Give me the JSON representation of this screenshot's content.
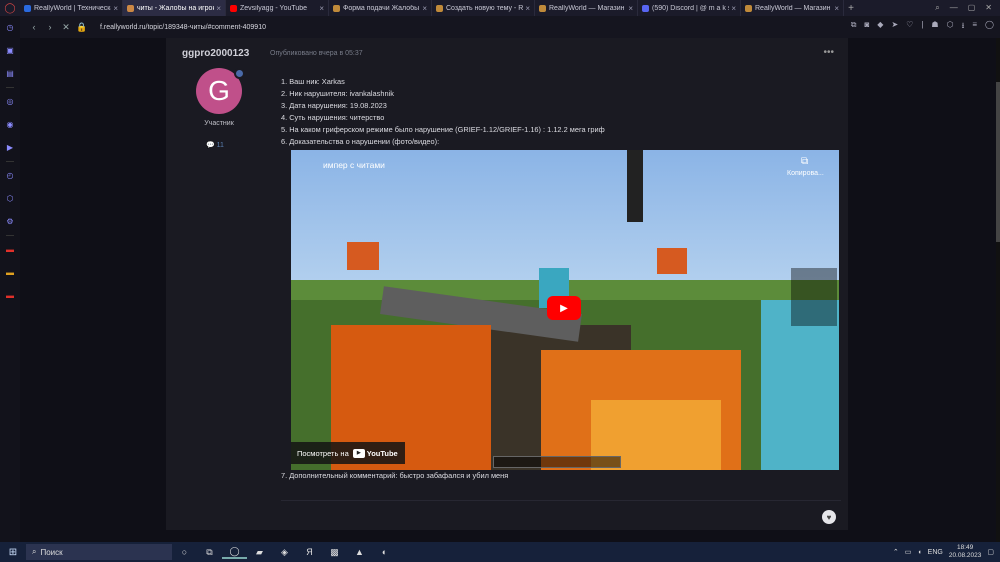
{
  "browser": {
    "tabs": [
      {
        "title": "ReallyWorld | Техническая",
        "fav_color": "#2a6adf"
      },
      {
        "title": "читы - Жалобы на игроков",
        "fav_color": "#cc8844",
        "active": true
      },
      {
        "title": "Zevsilyagg - YouTube",
        "fav_color": "#ff0000"
      },
      {
        "title": "Форма подачи Жалобы на",
        "fav_color": "#c08a3a"
      },
      {
        "title": "Создать новую тему - Re",
        "fav_color": "#c08a3a"
      },
      {
        "title": "ReallyWorld — Магазин р",
        "fav_color": "#c08a3a"
      },
      {
        "title": "(590) Discord | @ m a k s i",
        "fav_color": "#5865f2"
      },
      {
        "title": "ReallyWorld — Магазин р",
        "fav_color": "#c08a3a"
      }
    ],
    "close_glyph": "×",
    "new_tab_glyph": "+",
    "url": "f.reallyworld.ru/topic/189348-читы/#comment-409910"
  },
  "post": {
    "author": "ggpro2000123",
    "date": "Опубликовано вчера в 05:37",
    "avatar_letter": "G",
    "avatar_color": "#c0508a",
    "role": "Участник",
    "post_count": "11",
    "menu_glyph": "•••",
    "items": [
      "1. Ваш ник: Xarkas",
      "2. Ник нарушителя: ivankalashnik",
      "3. Дата нарушения: 19.08.2023",
      "4. Суть нарушения: читерство",
      "5. На каком гриферском режиме было нарушение (GRIEF-1.12/GRIEF-1.16) : 1.12.2 мега гриф",
      "6. Доказательства о нарушении (фото/видео):"
    ],
    "item7": "7. Дополнительный комментарий: быстро забафался и убил меня",
    "video": {
      "title": "импер с читами",
      "copy_label": "Копирова...",
      "watch_on": "Посмотреть на",
      "youtube": "YouTube"
    }
  },
  "taskbar": {
    "search": "Поиск",
    "lang": "ENG",
    "time": "18:49",
    "date": "20.08.2023"
  }
}
